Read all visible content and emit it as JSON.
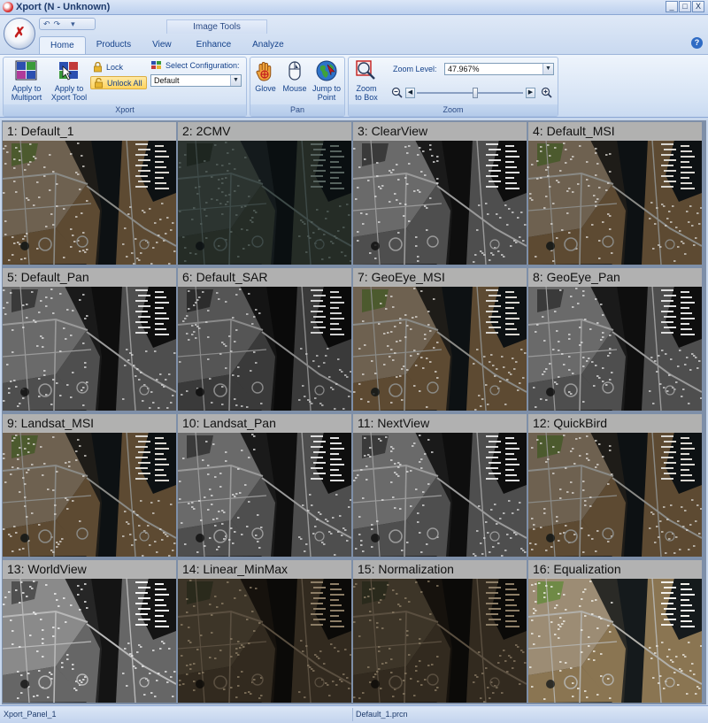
{
  "window": {
    "title": "Xport (N - Unknown)",
    "minimize": "_",
    "maximize": "□",
    "close": "X"
  },
  "qat": {
    "undo": "↶",
    "redo": "↷",
    "more": "▾"
  },
  "ribbon": {
    "context_group": "Image Tools",
    "tabs": [
      "Home",
      "Products",
      "View",
      "Enhance",
      "Analyze"
    ],
    "active_tab": "Home",
    "xport_group": {
      "label": "Xport",
      "apply_multiport": [
        "Apply to",
        "Multiport"
      ],
      "apply_xport": [
        "Apply to",
        "Xport Tool"
      ],
      "lock": "Lock",
      "unlock_all": "Unlock All",
      "select_config_label": "Select Configuration:",
      "config_value": "Default"
    },
    "pan_group": {
      "label": "Pan",
      "glove": "Glove",
      "mouse": "Mouse",
      "jump": [
        "Jump to",
        "Point"
      ]
    },
    "zoom_group": {
      "label": "Zoom",
      "zoom_to_box": [
        "Zoom",
        "to Box"
      ],
      "zoom_level_label": "Zoom Level:",
      "zoom_level_value": "47.967%",
      "zoom_slider_level": 0.55
    }
  },
  "panels": [
    {
      "label": "1: Default_1",
      "style": "color",
      "selected": true
    },
    {
      "label": "2: 2CMV",
      "style": "dark"
    },
    {
      "label": "3: ClearView",
      "style": "gray"
    },
    {
      "label": "4: Default_MSI",
      "style": "color"
    },
    {
      "label": "5: Default_Pan",
      "style": "gray"
    },
    {
      "label": "6: Default_SAR",
      "style": "graydark"
    },
    {
      "label": "7: GeoEye_MSI",
      "style": "color"
    },
    {
      "label": "8: GeoEye_Pan",
      "style": "gray"
    },
    {
      "label": "9: Landsat_MSI",
      "style": "color"
    },
    {
      "label": "10: Landsat_Pan",
      "style": "gray"
    },
    {
      "label": "11: NextView",
      "style": "gray"
    },
    {
      "label": "12: QuickBird",
      "style": "color"
    },
    {
      "label": "13: WorldView",
      "style": "graybright"
    },
    {
      "label": "14: Linear_MinMax",
      "style": "sepia"
    },
    {
      "label": "15: Normalization",
      "style": "sepia"
    },
    {
      "label": "16: Equalization",
      "style": "colorbright"
    }
  ],
  "status": {
    "left": "Xport_Panel_1",
    "middle": "Default_1.prcn"
  },
  "colors": {
    "selection": "#f0e20a",
    "ribbon": "#d7e4f5",
    "accent": "#15428b"
  }
}
